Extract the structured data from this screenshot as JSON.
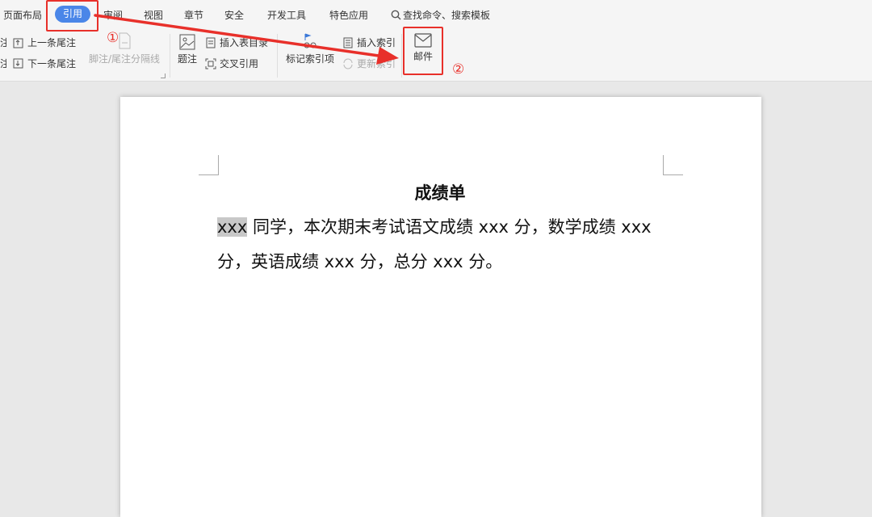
{
  "tabs": {
    "items": [
      "页面布局",
      "引用",
      "审阅",
      "视图",
      "章节",
      "安全",
      "开发工具",
      "特色应用"
    ],
    "active_index": 1,
    "search_label": "查找命令、搜索模板"
  },
  "ribbon": {
    "footnote_partial_label": "注",
    "prev_endnote": "上一条尾注",
    "next_endnote": "下一条尾注",
    "separator_line": "脚注/尾注分隔线",
    "caption": "题注",
    "insert_table_of_figures": "插入表目录",
    "cross_reference": "交叉引用",
    "mark_index_entry": "标记索引项",
    "insert_index": "插入索引",
    "update_index": "更新索引",
    "mail": "邮件"
  },
  "annotations": {
    "step1": "①",
    "step2": "②",
    "color": "#e8302a"
  },
  "document": {
    "title": "成绩单",
    "field": "xxx",
    "body_rest": " 同学，本次期末考试语文成绩 xxx 分，数学成绩 xxx 分，英语成绩 xxx 分，总分 xxx 分。"
  },
  "colors": {
    "active_tab": "#4a86e8",
    "field_highlight": "#c8c8c8"
  }
}
